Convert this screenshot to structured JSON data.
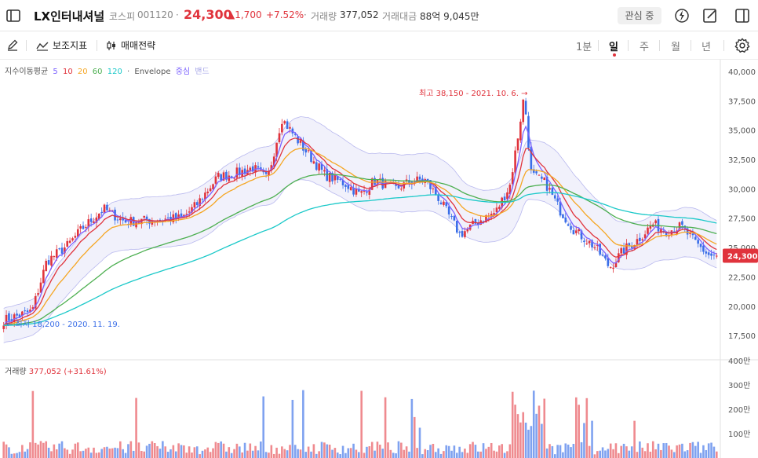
{
  "header": {
    "stock_name": "LX인터내셔널",
    "market": "코스피",
    "code": "001120",
    "separator": "·",
    "price": "24,300",
    "change": "▲1,700",
    "change_pct": "+7.52%",
    "volume_label": "거래량",
    "volume_value": "377,052",
    "amount_label": "거래대금",
    "amount_value": "88억 9,045만",
    "watch_label": "관심 중"
  },
  "toolbar": {
    "draw_label": "",
    "indicator_label": "보조지표",
    "strategy_label": "매매전략",
    "periods": [
      "1분",
      "일",
      "주",
      "월",
      "년"
    ],
    "active_period": "일"
  },
  "legend": {
    "ma_label": "지수이동평균",
    "ma_periods": [
      "5",
      "10",
      "20",
      "60",
      "120"
    ],
    "ma_colors": [
      "#7b61ff",
      "#e0333c",
      "#f5a623",
      "#4caf50",
      "#1cc9c9"
    ],
    "dot": "·",
    "envelope_label": "Envelope",
    "envelope_center": "중심",
    "envelope_band": "밴드"
  },
  "annotations": {
    "high": "최고 38,150 - 2021. 10. 6. →",
    "low": "← 최저 18,200 - 2020. 11. 19."
  },
  "price_axis": {
    "ticks": [
      "40,000",
      "37,500",
      "35,000",
      "32,500",
      "30,000",
      "27,500",
      "25,000",
      "22,500",
      "20,000",
      "17,500"
    ],
    "current_tag": "24,300"
  },
  "volume": {
    "label": "거래량",
    "value": "377,052 (+31.61%)",
    "ticks": [
      "400만",
      "300만",
      "200만",
      "100만"
    ]
  },
  "chart_data": {
    "type": "candlestick",
    "y_range": [
      15500,
      41000
    ],
    "volume_range_10k": [
      0,
      400
    ],
    "close_path_anchors": [
      [
        0,
        18800
      ],
      [
        0.04,
        19600
      ],
      [
        0.06,
        23800
      ],
      [
        0.09,
        25200
      ],
      [
        0.11,
        26600
      ],
      [
        0.14,
        28300
      ],
      [
        0.17,
        27200
      ],
      [
        0.22,
        27400
      ],
      [
        0.25,
        27500
      ],
      [
        0.27,
        28600
      ],
      [
        0.3,
        31000
      ],
      [
        0.33,
        31400
      ],
      [
        0.35,
        31800
      ],
      [
        0.37,
        30800
      ],
      [
        0.39,
        36000
      ],
      [
        0.42,
        33500
      ],
      [
        0.45,
        31200
      ],
      [
        0.48,
        30400
      ],
      [
        0.5,
        29500
      ],
      [
        0.52,
        30700
      ],
      [
        0.55,
        30000
      ],
      [
        0.57,
        30600
      ],
      [
        0.59,
        30800
      ],
      [
        0.61,
        29200
      ],
      [
        0.64,
        26100
      ],
      [
        0.67,
        27400
      ],
      [
        0.69,
        28000
      ],
      [
        0.71,
        30300
      ],
      [
        0.72,
        34000
      ],
      [
        0.73,
        38000
      ],
      [
        0.74,
        31200
      ],
      [
        0.76,
        30500
      ],
      [
        0.78,
        28200
      ],
      [
        0.8,
        26500
      ],
      [
        0.83,
        25000
      ],
      [
        0.85,
        23300
      ],
      [
        0.87,
        24800
      ],
      [
        0.89,
        25700
      ],
      [
        0.91,
        27000
      ],
      [
        0.93,
        26400
      ],
      [
        0.95,
        26800
      ],
      [
        0.97,
        25400
      ],
      [
        0.99,
        24300
      ]
    ]
  },
  "colors": {
    "up": "#e0333c",
    "down": "#3a6ee8",
    "envelope_fill": "#f1f1fb",
    "envelope_line": "#b8b8ee"
  }
}
